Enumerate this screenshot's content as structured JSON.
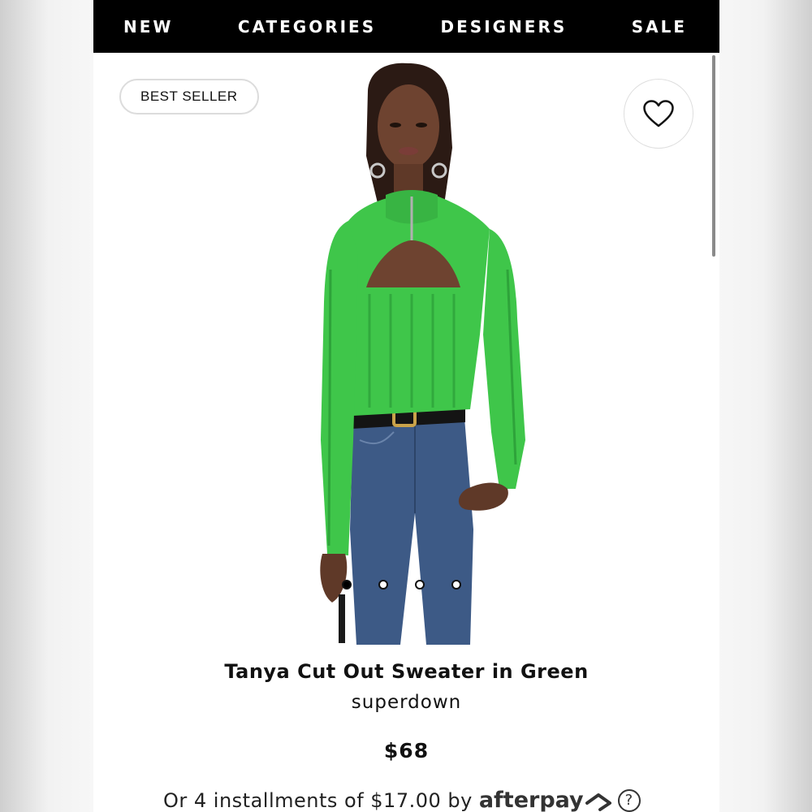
{
  "nav": {
    "items": [
      "NEW",
      "CATEGORIES",
      "DESIGNERS",
      "SALE"
    ]
  },
  "product": {
    "badge": "BEST SELLER",
    "title": "Tanya Cut Out Sweater in Green",
    "brand": "superdown",
    "price": "$68",
    "installments_text": "Or 4 installments of $17.00 by",
    "installments_provider": "afterpay",
    "help_symbol": "?",
    "image_carousel": {
      "total": 4,
      "current": 1
    }
  },
  "icons": {
    "wishlist": "heart-outline-icon",
    "afterpay_logo": "afterpay-arrows-icon",
    "help": "question-circle-icon"
  },
  "colors": {
    "nav_background": "#000000",
    "sweater_green": "#3fc64a",
    "jeans_blue": "#3d5a86"
  }
}
